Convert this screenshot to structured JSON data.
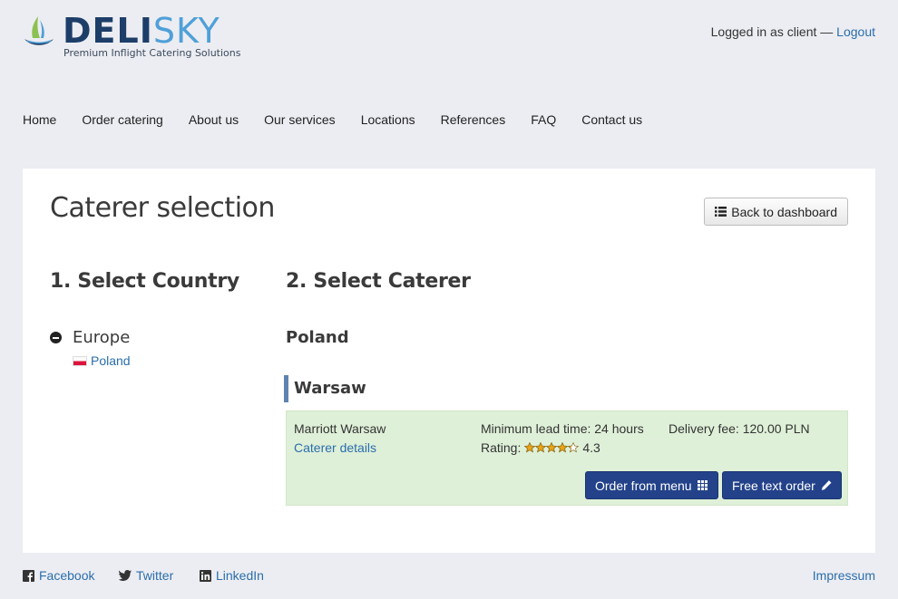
{
  "brand": {
    "name_part1": "DELI",
    "name_part2": "SKY",
    "tagline": "Premium Inflight Catering Solutions",
    "colors": {
      "dark": "#1d3e69",
      "light": "#4fa0d8"
    }
  },
  "userbar": {
    "status": "Logged in as client —",
    "logout": "Logout"
  },
  "nav": [
    {
      "label": "Home"
    },
    {
      "label": "Order catering"
    },
    {
      "label": "About us"
    },
    {
      "label": "Our services"
    },
    {
      "label": "Locations"
    },
    {
      "label": "References"
    },
    {
      "label": "FAQ"
    },
    {
      "label": "Contact us"
    }
  ],
  "page": {
    "title": "Caterer selection",
    "back_button": "Back to dashboard",
    "step1_title": "1. Select Country",
    "step2_title": "2. Select Caterer"
  },
  "tree": {
    "region": "Europe",
    "country": "Poland"
  },
  "selection": {
    "country": "Poland",
    "city": "Warsaw",
    "caterer": {
      "name": "Marriott Warsaw",
      "details_link": "Caterer details",
      "lead_time": "Minimum lead time: 24 hours",
      "delivery_fee": "Delivery fee: 120.00 PLN",
      "rating_label": "Rating:",
      "rating_value": "4.3",
      "rating_stars": 4.3,
      "order_menu_button": "Order from menu",
      "free_text_button": "Free text order"
    }
  },
  "footer": {
    "facebook": "Facebook",
    "twitter": "Twitter",
    "linkedin": "LinkedIn",
    "impressum": "Impressum"
  },
  "colors": {
    "link": "#2a6ead",
    "primary_button": "#23428a",
    "card_bg": "#dff0d8",
    "star": "#e8a317"
  }
}
